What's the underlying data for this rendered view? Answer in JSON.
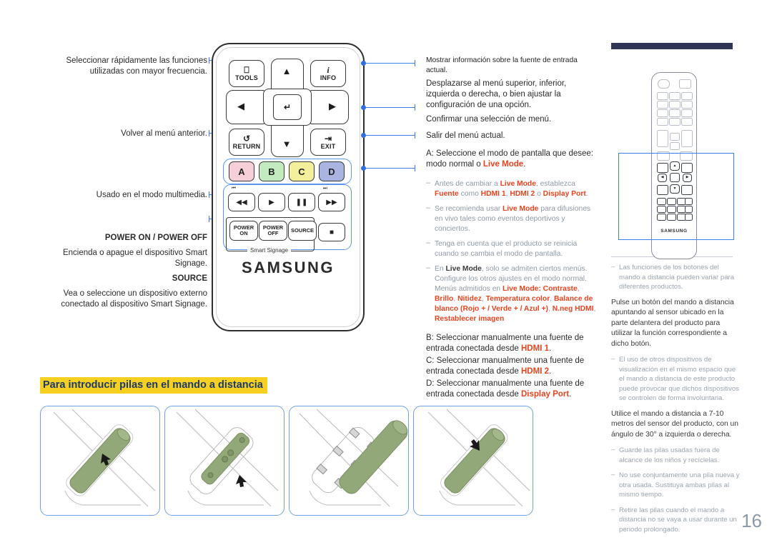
{
  "page": {
    "number": "16"
  },
  "left_callouts": [
    {
      "name": "tools",
      "lines": [
        "Seleccionar rápidamente las funciones",
        "utilizadas con mayor frecuencia."
      ]
    },
    {
      "name": "return",
      "lines": [
        "Volver al menú anterior."
      ]
    },
    {
      "name": "media",
      "lines": [
        "Usado en el modo multimedia."
      ]
    }
  ],
  "left_power_section": {
    "title": "POWER ON / POWER OFF",
    "body": [
      "Encienda o apague el dispositivo Smart",
      "Signage."
    ],
    "subtitle": "SOURCE",
    "subbody": [
      "Vea o seleccione un dispositivo externo",
      "conectado al dispositivo Smart Signage."
    ]
  },
  "remote": {
    "buttons": {
      "tools": "TOOLS",
      "info": "INFO",
      "return": "RETURN",
      "exit": "EXIT",
      "color_a": "A",
      "color_b": "B",
      "color_c": "C",
      "color_d": "D",
      "power_on_1": "POWER",
      "power_on_2": "ON",
      "power_off_1": "POWER",
      "power_off_2": "OFF",
      "source": "SOURCE"
    },
    "smart_signage_label": "Smart Signage",
    "brand": "SAMSUNG",
    "colors": {
      "a": "#f6cfd9",
      "b": "#c2ebc0",
      "c": "#f4ef9c",
      "d": "#aab4e0",
      "leader": "#3d7fe8",
      "highlight": "#5b94ef"
    }
  },
  "right_callouts": {
    "info": "Mostrar información sobre la fuente de entrada actual.",
    "nav": [
      "Desplazarse al menú superior, inferior,",
      "izquierda o derecha, o bien ajustar la",
      "configuración de una opción."
    ],
    "enter": "Confirmar una selección de menú.",
    "exit": "Salir del menú actual.",
    "a_line1": "A: Seleccione el modo de pantalla que desee:",
    "a_line2_pre": "modo normal o ",
    "a_line2_red": "Live Mode",
    "a_line2_post": ".",
    "notes": [
      {
        "segs": [
          {
            "t": "Antes de cambiar a ",
            "s": "p"
          },
          {
            "t": "Live Mode",
            "s": "r"
          },
          {
            "t": ", establezca ",
            "s": "p"
          },
          {
            "t": "Fuente",
            "s": "r"
          },
          {
            "t": " como ",
            "s": "p"
          },
          {
            "t": "HDMI 1",
            "s": "r"
          },
          {
            "t": ", ",
            "s": "p"
          },
          {
            "t": "HDMI 2",
            "s": "r"
          },
          {
            "t": " o ",
            "s": "p"
          },
          {
            "t": "Display Port",
            "s": "r"
          },
          {
            "t": ".",
            "s": "p"
          }
        ]
      },
      {
        "segs": [
          {
            "t": "Se recomienda usar ",
            "s": "p"
          },
          {
            "t": "Live Mode",
            "s": "r"
          },
          {
            "t": " para difusiones en vivo tales como eventos deportivos y conciertos.",
            "s": "p"
          }
        ]
      },
      {
        "segs": [
          {
            "t": "Tenga en cuenta que el producto se reinicia cuando se cambia el modo de pantalla.",
            "s": "p"
          }
        ]
      },
      {
        "segs": [
          {
            "t": "En ",
            "s": "p"
          },
          {
            "t": "Live Mode",
            "s": "b"
          },
          {
            "t": ", solo se admiten ciertos menús. Configure los otros ajustes en el modo normal. Menús admitidos en ",
            "s": "p"
          },
          {
            "t": "Live Mode: Contraste",
            "s": "r"
          },
          {
            "t": ", ",
            "s": "p"
          },
          {
            "t": "Brillo",
            "s": "r"
          },
          {
            "t": ", ",
            "s": "p"
          },
          {
            "t": "Nitidez",
            "s": "r"
          },
          {
            "t": ", ",
            "s": "p"
          },
          {
            "t": "Temperatura color",
            "s": "r"
          },
          {
            "t": ", ",
            "s": "p"
          },
          {
            "t": "Balance de blanco (Rojo + / Verde + / Azul +)",
            "s": "r"
          },
          {
            "t": ", ",
            "s": "p"
          },
          {
            "t": "N.neg HDMI",
            "s": "r"
          },
          {
            "t": ", ",
            "s": "p"
          },
          {
            "t": "Restablecer imagen",
            "s": "r"
          }
        ]
      }
    ],
    "b_pre": "B: Seleccionar manualmente una fuente de entrada conectada desde ",
    "b_red": "HDMI 1",
    "c_pre": "C: Seleccionar manualmente una fuente de entrada conectada desde ",
    "c_red": "HDMI 2",
    "d_pre": "D: Seleccionar manualmente una fuente de entrada conectada desde ",
    "d_red": "Display Port"
  },
  "sidebar": {
    "brand": "SAMSUNG",
    "notes_top": [
      "Las funciones de los botones del mando a distancia pueden variar para diferentes productos."
    ],
    "para1": "Pulse un botón del mando a distancia apuntando al sensor ubicado en la parte delantera del producto para utilizar la función correspondiente a dicho botón.",
    "note2": "El uso de otros dispositivos de visualización en el mismo espacio que el mando a distancia de este producto puede provocar que dichos dispositivos se controlen de forma involuntaria.",
    "para2": "Utilice el mando a distancia a 7-10 metros del sensor del producto, con un ángulo de 30° a izquierda o derecha.",
    "note3": "Guarde las pilas usadas fuera de alcance de los niños y recíclelas.",
    "note4": "No use conjuntamente una pila nueva y otra usada. Sustituya ambas pilas al mismo tiempo.",
    "note5": "Retire las pilas cuando el mando a distancia no se vaya a usar durante un periodo prolongado."
  },
  "battery_section": {
    "heading": "Para introducir pilas en el mando a distancia",
    "steps": [
      "step-1",
      "step-2",
      "step-3",
      "step-4"
    ],
    "battery_color": "#93a878",
    "border_color": "#6fa0e8"
  }
}
